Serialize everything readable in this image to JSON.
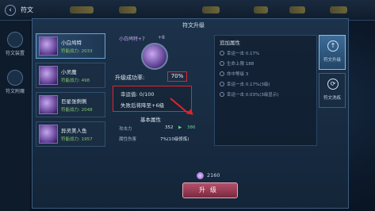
{
  "topbar": {
    "back_icon": "back-arrow-icon",
    "title": "符文"
  },
  "left_rail": {
    "items": [
      {
        "label": "符文装置"
      },
      {
        "label": "符文附魔"
      }
    ]
  },
  "panel": {
    "title": "符文升级"
  },
  "rune_list": [
    {
      "name": "小白鸠特",
      "power": "符能战力: 2033"
    },
    {
      "name": "小灵魔",
      "power": "符能战力: 498"
    },
    {
      "name": "巨星张俐俐",
      "power": "符能战力: 2048"
    },
    {
      "name": "异灵美人鱼",
      "power": "符能战力: 1957"
    }
  ],
  "upgrade": {
    "current_name": "小白鸠特+7",
    "next_level": "+8",
    "rate_label": "升级成功率:",
    "rate_value": "70%",
    "luck": "幸运值: 0/100",
    "fail_text": "失败后将降至+6级"
  },
  "base_attrs": {
    "title": "基本属性",
    "rows": [
      {
        "key": "攻击力",
        "value": "352",
        "next": "386"
      },
      {
        "key": "属性伤害",
        "value": "7%(10级修炼)",
        "next": ""
      }
    ]
  },
  "right_panel": {
    "header": "追加属性",
    "rows": [
      {
        "text": "幸运一击 0.17%"
      },
      {
        "text": "生命上限 188"
      },
      {
        "text": "命中等级 3"
      },
      {
        "text": "幸运一击 0.17%(3级)"
      },
      {
        "text": "幸运一击 0.03%(3级显示)"
      }
    ]
  },
  "tabs": [
    {
      "label": "符文升级",
      "icon": "up-arrow-icon"
    },
    {
      "label": "符文洗练",
      "icon": "cycle-icon"
    }
  ],
  "cost": {
    "value": "2160"
  },
  "upgrade_button": {
    "label": "升级"
  }
}
